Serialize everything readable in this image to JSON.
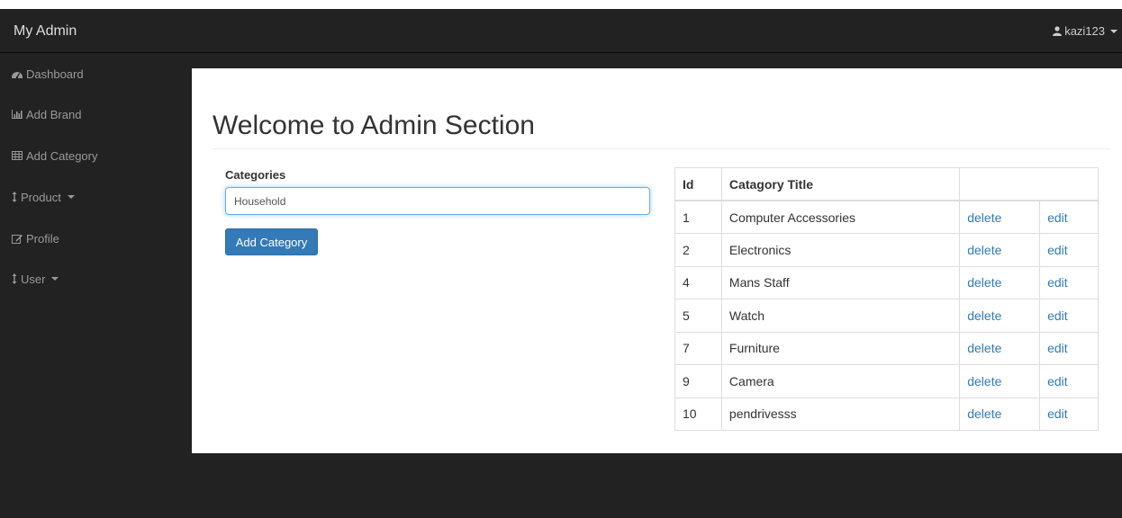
{
  "navbar": {
    "brand": "My Admin",
    "user": {
      "name": "kazi123",
      "icon": "user-icon"
    }
  },
  "sidebar": {
    "items": [
      {
        "label": "Dashboard",
        "icon": "dashboard-icon"
      },
      {
        "label": "Add Brand",
        "icon": "bar-chart-icon"
      },
      {
        "label": "Add Category",
        "icon": "table-icon"
      },
      {
        "label": "Product",
        "icon": "vertical-resize-icon",
        "dropdown": true
      },
      {
        "label": "Profile",
        "icon": "edit-icon"
      },
      {
        "label": "User",
        "icon": "vertical-resize-icon",
        "dropdown": true
      }
    ]
  },
  "main": {
    "title": "Welcome to Admin Section",
    "form": {
      "label": "Categories",
      "input_value": "Household",
      "submit_label": "Add Category"
    },
    "table": {
      "headers": [
        "Id",
        "Catagory Title",
        ""
      ],
      "rows": [
        {
          "id": "1",
          "title": "Computer Accessories",
          "delete": "delete",
          "edit": "edit"
        },
        {
          "id": "2",
          "title": "Electronics",
          "delete": "delete",
          "edit": "edit"
        },
        {
          "id": "4",
          "title": "Mans Staff",
          "delete": "delete",
          "edit": "edit"
        },
        {
          "id": "5",
          "title": "Watch",
          "delete": "delete",
          "edit": "edit"
        },
        {
          "id": "7",
          "title": "Furniture",
          "delete": "delete",
          "edit": "edit"
        },
        {
          "id": "9",
          "title": "Camera",
          "delete": "delete",
          "edit": "edit"
        },
        {
          "id": "10",
          "title": "pendrivesss",
          "delete": "delete",
          "edit": "edit"
        }
      ]
    }
  },
  "colors": {
    "navbar_bg": "#222222",
    "content_bg": "#ffffff",
    "primary": "#337ab7",
    "link": "#337ab7"
  }
}
